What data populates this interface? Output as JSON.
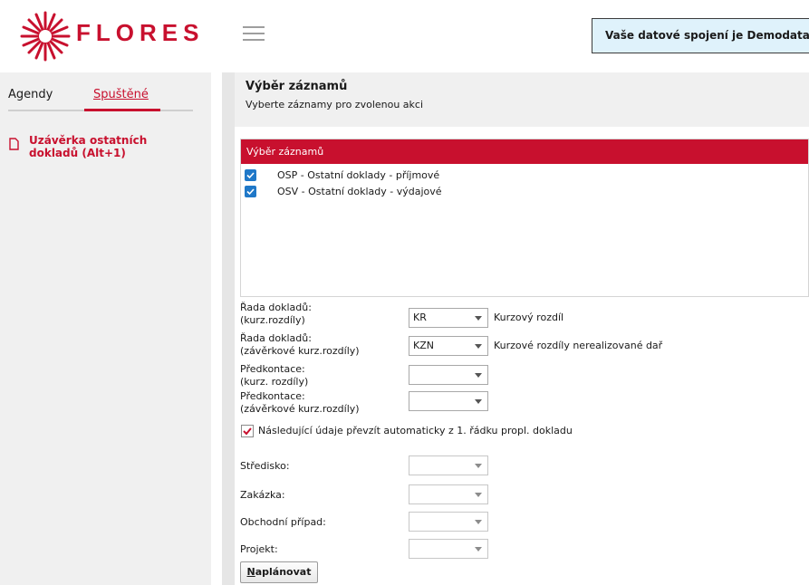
{
  "header": {
    "brand": "FLORES",
    "connection_text": "Vaše datové spojení je Demodata",
    "colors": {
      "brand_red": "#c8102e",
      "connection_bg": "#dff2fb"
    }
  },
  "sidebar": {
    "tabs": [
      {
        "label": "Agendy",
        "active": false
      },
      {
        "label": "Spuštěné",
        "active": true
      }
    ],
    "items": [
      {
        "label_line1": "Uzávěrka ostatních",
        "label_line2": "dokladů (Alt+1)",
        "icon": "document-icon"
      }
    ]
  },
  "main": {
    "title": "Výběr záznamů",
    "subtitle": "Vyberte záznamy pro zvolenou akci",
    "list": {
      "header": "Výběr záznamů",
      "rows": [
        {
          "label": "OSP - Ostatní doklady - příjmové",
          "checked": true
        },
        {
          "label": "OSV - Ostatní doklady - výdajové",
          "checked": true
        }
      ]
    },
    "form": {
      "rada_kurz": {
        "label1": "Řada dokladů:",
        "label2": "(kurz.rozdíly)",
        "value": "KR",
        "desc": "Kurzový rozdíl"
      },
      "rada_zaverk": {
        "label1": "Řada dokladů:",
        "label2": "(závěrkové kurz.rozdíly)",
        "value": "KZN",
        "desc": "Kurzové rozdíly nerealizované dař"
      },
      "predk_kurz": {
        "label1": "Předkontace:",
        "label2": "(kurz. rozdíly)",
        "value": ""
      },
      "predk_zaverk": {
        "label1": "Předkontace:",
        "label2": "(závěrkové kurz.rozdíly)",
        "value": ""
      },
      "auto_check": {
        "label": "Následující údaje převzít automaticky z 1. řádku propl. dokladu",
        "checked": true
      },
      "stredisko": {
        "label": "Středisko:",
        "value": ""
      },
      "zakazka": {
        "label": "Zakázka:",
        "value": ""
      },
      "obchodni_pripad": {
        "label": "Obchodní případ:",
        "value": ""
      },
      "projekt": {
        "label": "Projekt:",
        "value": ""
      }
    },
    "button": {
      "label_underlined": "N",
      "label_rest": "aplánovat"
    }
  }
}
